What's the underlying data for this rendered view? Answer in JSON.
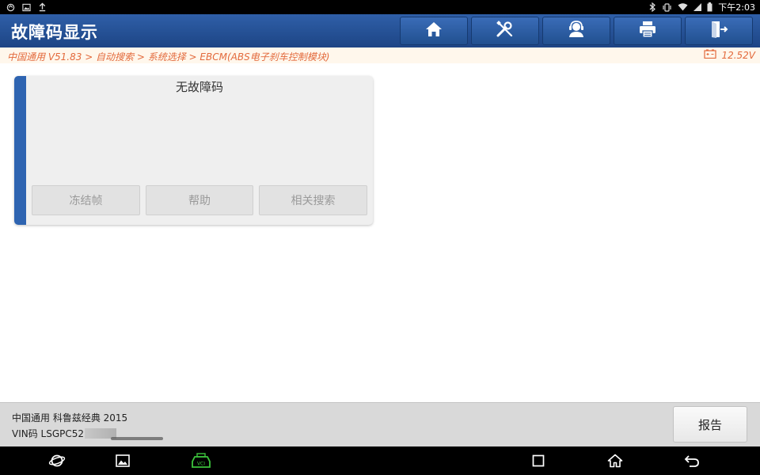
{
  "statusbar": {
    "time": "下午2:03",
    "icons_left": [
      "sync-icon",
      "image-icon",
      "upload-icon"
    ],
    "icons_right": [
      "bluetooth-icon",
      "vibrate-icon",
      "wifi-icon",
      "signal-icon",
      "battery-icon"
    ]
  },
  "header": {
    "title": "故障码显示",
    "buttons": [
      "home-icon",
      "diagnostic-tools-icon",
      "support-agent-icon",
      "print-icon",
      "exit-icon"
    ]
  },
  "breadcrumb": {
    "path": "中国通用 V51.83 > 自动搜索 > 系统选择 > EBCM(ABS电子刹车控制模块)",
    "voltage": "12.52V"
  },
  "card": {
    "message": "无故障码",
    "buttons": {
      "freeze_frame": "冻结帧",
      "help": "帮助",
      "related_search": "相关搜索"
    }
  },
  "footer": {
    "vehicle": "中国通用 科鲁兹经典 2015",
    "vin_label": "VIN码 LSGPC52",
    "report_label": "报告"
  },
  "colors": {
    "header_blue": "#2f5fa8",
    "accent_blue": "#2e64b1",
    "breadcrumb_orange": "#e36a3c",
    "vci_green": "#3cc43c"
  }
}
